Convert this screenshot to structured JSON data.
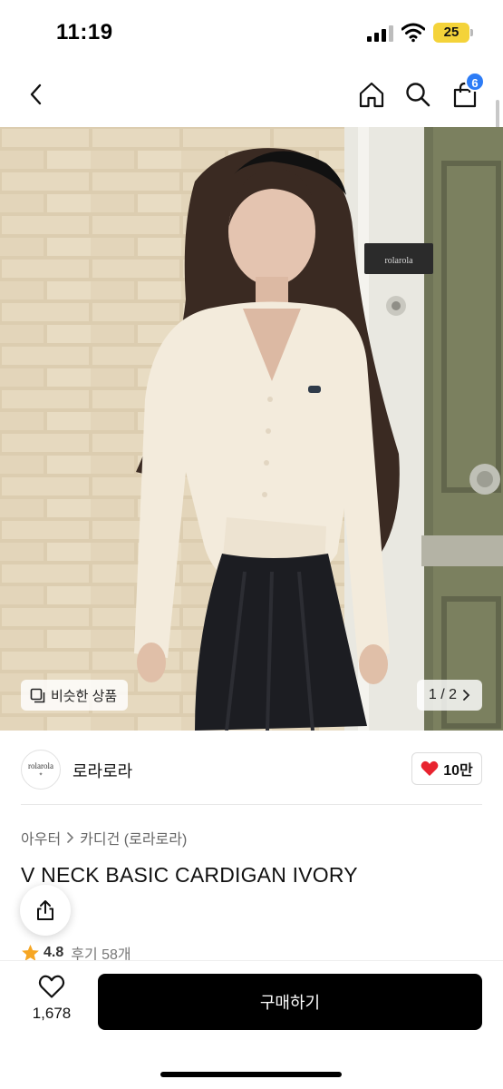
{
  "status_bar": {
    "time": "11:19",
    "battery": "25",
    "signal_icon": "signal-icon",
    "wifi_icon": "wifi-icon"
  },
  "nav": {
    "back_icon": "chevron-left-icon",
    "home_icon": "home-icon",
    "search_icon": "search-icon",
    "cart_icon": "shopping-bag-icon",
    "cart_count": "6"
  },
  "hero": {
    "similar_products_label": "비슷한 상품",
    "page_indicator": "1 / 2",
    "door_plate_text": "rolarola"
  },
  "brand": {
    "logo_text": "rolarola",
    "name": "로라로라",
    "likes": "10만"
  },
  "product": {
    "breadcrumb": [
      "아우터",
      "카디건 (로라로라)"
    ],
    "title": "V NECK BASIC CARDIGAN IVORY",
    "rating": "4.8",
    "reviews": "후기 58개"
  },
  "bottom_bar": {
    "wish_count": "1,678",
    "buy_label": "구매하기"
  },
  "colors": {
    "accent_blue": "#2d7cf6",
    "heart_red": "#e8232f",
    "star_orange": "#f6a623",
    "buy_button": "#000000",
    "battery_yellow": "#f4d33a"
  }
}
